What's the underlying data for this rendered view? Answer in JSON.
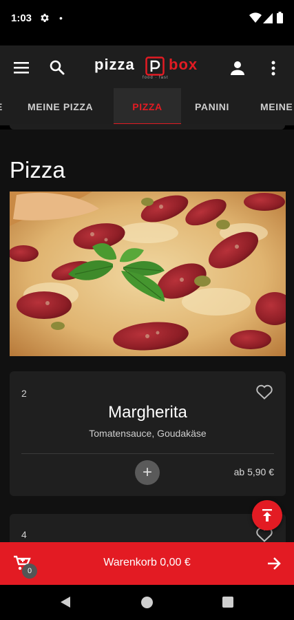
{
  "status": {
    "time": "1:03",
    "dot": "•"
  },
  "header": {
    "logo_left": "pizza",
    "logo_right": "box",
    "logo_tagline": "food · fast"
  },
  "tabs": [
    {
      "label": "E"
    },
    {
      "label": "MEINE PIZZA"
    },
    {
      "label": "PIZZA",
      "active": true
    },
    {
      "label": "PANINI"
    },
    {
      "label": "MEINE"
    }
  ],
  "section": {
    "title": "Pizza"
  },
  "products": [
    {
      "number": "2",
      "name": "Margherita",
      "description": "Tomatensauce, Goudakäse",
      "price": "ab 5,90 €",
      "add_label": "+"
    },
    {
      "number": "4"
    }
  ],
  "cart": {
    "label": "Warenkorb 0,00 €",
    "count": "0"
  },
  "colors": {
    "accent": "#e31b23",
    "background": "#111111",
    "card": "#1f1f1f",
    "appbar": "#1e1e1e"
  },
  "icons": [
    "settings-gear-icon",
    "wifi-icon",
    "signal-icon",
    "battery-icon",
    "menu-icon",
    "search-icon",
    "account-icon",
    "more-vert-icon",
    "heart-outline-icon",
    "cart-icon",
    "arrow-right-icon",
    "scroll-top-icon",
    "back-triangle-icon",
    "home-circle-icon",
    "recents-square-icon"
  ]
}
